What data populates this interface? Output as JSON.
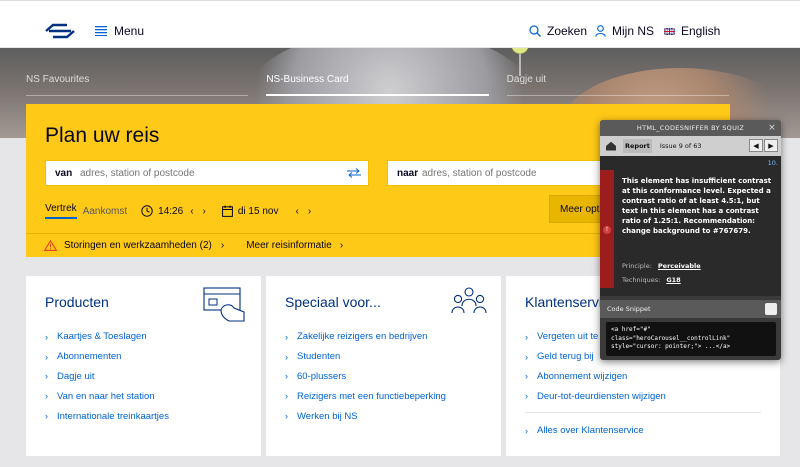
{
  "header": {
    "menu_label": "Menu",
    "search_label": "Zoeken",
    "account_label": "Mijn NS",
    "language_label": "English"
  },
  "carousel": {
    "tabs": [
      "NS Favourites",
      "NS-Business Card",
      "Dagje uit"
    ],
    "active_index": 1
  },
  "planner": {
    "title": "Plan uw reis",
    "from_label": "van",
    "from_placeholder": "adres, station of postcode",
    "to_label": "naar",
    "to_placeholder": "adres, station of postcode",
    "departure_tab": "Vertrek",
    "arrival_tab": "Aankomst",
    "time": "14:26",
    "date": "di 15 nov",
    "more_options_button": "Meer opti",
    "alert_text": "Storingen en werkzaamheden (2)",
    "more_info_link": "Meer reisinformatie"
  },
  "cards": [
    {
      "title": "Producten",
      "icon": "card-hand-icon",
      "items": [
        "Kaartjes & Toeslagen",
        "Abonnementen",
        "Dagje uit",
        "Van en naar het station",
        "Internationale treinkaartjes"
      ]
    },
    {
      "title": "Speciaal voor...",
      "icon": "people-icon",
      "items": [
        "Zakelijke reizigers en bedrijven",
        "Studenten",
        "60-plussers",
        "Reizigers met een functiebeperking",
        "Werken bij NS"
      ]
    },
    {
      "title": "Klantenservi",
      "items": [
        "Vergeten uit te",
        "Geld terug bij",
        "Abonnement wijzigen",
        "Deur-tot-deurdiensten wijzigen"
      ],
      "footer_link": "Alles over Klantenservice"
    }
  ],
  "sniffer": {
    "title": "HTML_CODESNIFFER BY SQUIZ",
    "close": "×",
    "report_button": "Report",
    "issue_counter": "Issue 9 of 63",
    "issue_number": "10.",
    "message": "This element has insufficient contrast at this conformance level. Expected a contrast ratio of at least 4.5:1, but text in this element has a contrast ratio of 1.25:1. Recommendation: change background to #767679.",
    "principle_label": "Principle:",
    "principle_value": "Perceivable",
    "techniques_label": "Techniques:",
    "techniques_value": "G18",
    "code_header": "Code Snippet",
    "code": "<a href=\"#\"\nclass=\"heroCarousel__controlLink\"\nstyle=\"cursor: pointer;\"> ...</a>"
  },
  "colors": {
    "brand_yellow": "#ffc917",
    "brand_blue": "#003082",
    "link_blue": "#0063d3",
    "alert_orange": "#e6431b"
  }
}
